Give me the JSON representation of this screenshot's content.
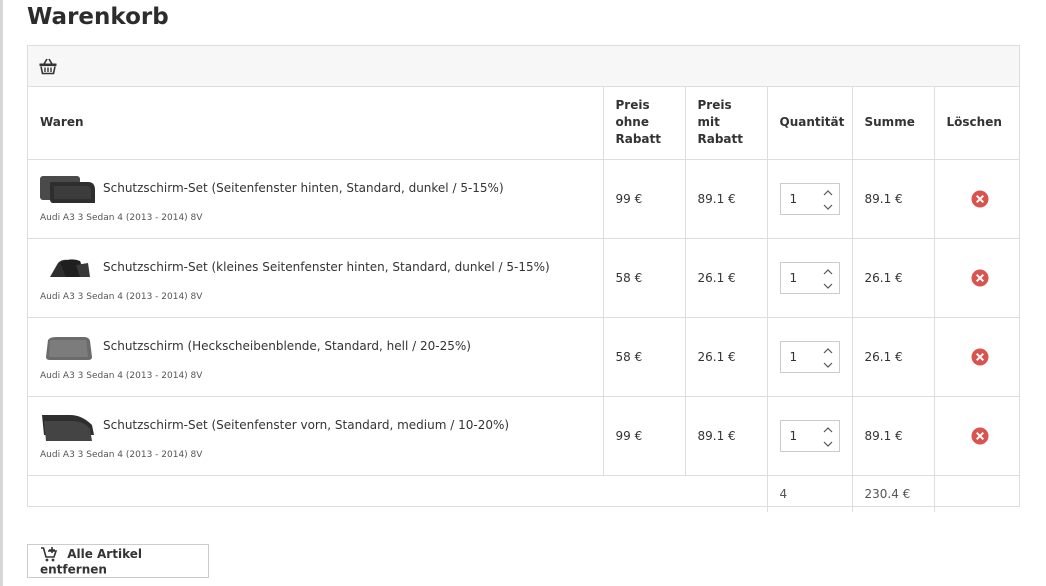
{
  "page": {
    "title": "Warenkorb"
  },
  "header_icon": "basket-icon",
  "table": {
    "headers": {
      "waren": "Waren",
      "preis_ohne": "Preis ohne Rabatt",
      "preis_mit": "Preis mit Rabatt",
      "quantitaet": "Quantität",
      "summe": "Summe",
      "loeschen": "Löschen"
    },
    "rows": [
      {
        "name": "Schutzschirm-Set (Seitenfenster hinten, Standard, dunkel / 5-15%)",
        "vehicle": "Audi A3 3 Sedan 4 (2013 - 2014) 8V",
        "price": "99 €",
        "price_discount": "89.1 €",
        "qty": "1",
        "sum": "89.1 €",
        "thumb": "rear-side-shades"
      },
      {
        "name": "Schutzschirm-Set (kleines Seitenfenster hinten, Standard, dunkel / 5-15%)",
        "vehicle": "Audi A3 3 Sedan 4 (2013 - 2014) 8V",
        "price": "58 €",
        "price_discount": "26.1 €",
        "qty": "1",
        "sum": "26.1 €",
        "thumb": "small-rear-shades"
      },
      {
        "name": "Schutzschirm (Heckscheibenblende, Standard, hell / 20-25%)",
        "vehicle": "Audi A3 3 Sedan 4 (2013 - 2014) 8V",
        "price": "58 €",
        "price_discount": "26.1 €",
        "qty": "1",
        "sum": "26.1 €",
        "thumb": "rear-window-shade"
      },
      {
        "name": "Schutzschirm-Set (Seitenfenster vorn, Standard, medium / 10-20%)",
        "vehicle": "Audi A3 3 Sedan 4 (2013 - 2014) 8V",
        "price": "99 €",
        "price_discount": "89.1 €",
        "qty": "1",
        "sum": "89.1 €",
        "thumb": "front-side-shades"
      }
    ],
    "totals": {
      "qty": "4",
      "sum": "230.4 €"
    }
  },
  "buttons": {
    "remove_all": "Alle Artikel entfernen"
  },
  "colors": {
    "delete": "#d9534f",
    "border": "#dddddd",
    "header_bg": "#f7f7f7"
  }
}
